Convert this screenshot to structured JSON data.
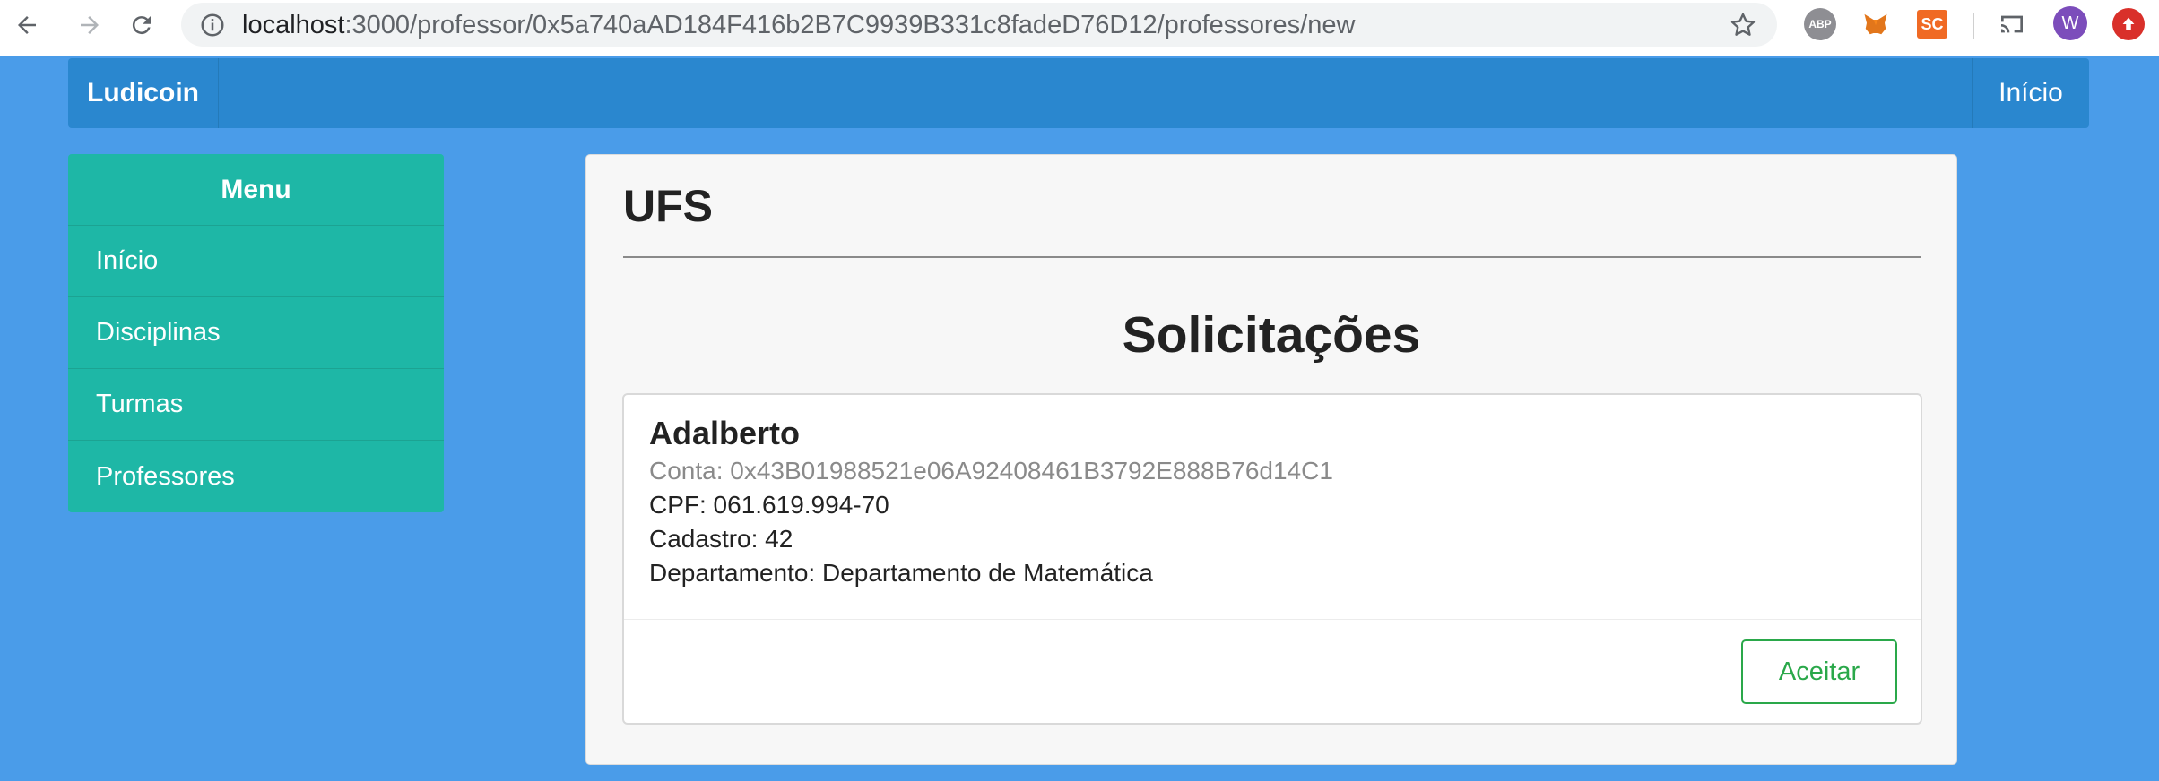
{
  "browser": {
    "url_host": "localhost",
    "url_path": ":3000/professor/0x5a740aAD184F416b2B7C9939B331c8fadeD76D12/professores/new",
    "extensions": {
      "abp": "ABP",
      "sc": "SC",
      "user": "W"
    }
  },
  "navbar": {
    "brand": "Ludicoin",
    "home_link": "Início"
  },
  "sidebar": {
    "title": "Menu",
    "items": [
      {
        "label": "Início"
      },
      {
        "label": "Disciplinas"
      },
      {
        "label": "Turmas"
      },
      {
        "label": "Professores"
      }
    ]
  },
  "main": {
    "title": "UFS",
    "section_title": "Solicitações",
    "request": {
      "name": "Adalberto",
      "account": "Conta: 0x43B01988521e06A92408461B3792E888B76d14C1",
      "cpf": "CPF: 061.619.994-70",
      "registration": "Cadastro: 42",
      "department": "Departamento: Departamento de Matemática",
      "accept_label": "Aceitar"
    }
  }
}
